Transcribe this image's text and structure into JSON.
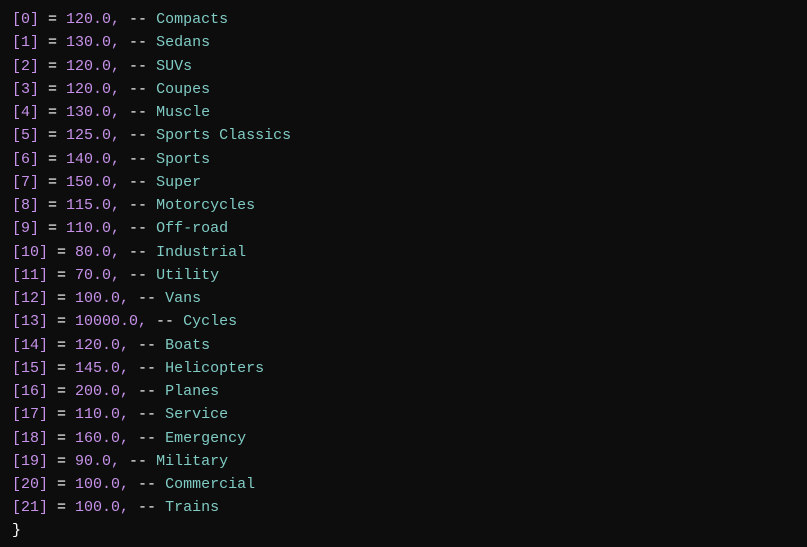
{
  "lines": [
    {
      "index": "[0]",
      "value": "120.0",
      "category": "Compacts"
    },
    {
      "index": "[1]",
      "value": "130.0",
      "category": "Sedans"
    },
    {
      "index": "[2]",
      "value": "120.0",
      "category": "SUVs"
    },
    {
      "index": "[3]",
      "value": "120.0",
      "category": "Coupes"
    },
    {
      "index": "[4]",
      "value": "130.0",
      "category": "Muscle"
    },
    {
      "index": "[5]",
      "value": "125.0",
      "category": "Sports Classics"
    },
    {
      "index": "[6]",
      "value": "140.0",
      "category": "Sports"
    },
    {
      "index": "[7]",
      "value": "150.0",
      "category": "Super"
    },
    {
      "index": "[8]",
      "value": "115.0",
      "category": "Motorcycles"
    },
    {
      "index": "[9]",
      "value": "110.0",
      "category": "Off-road"
    },
    {
      "index": "[10]",
      "value": "80.0",
      "category": "Industrial"
    },
    {
      "index": "[11]",
      "value": "70.0",
      "category": "Utility"
    },
    {
      "index": "[12]",
      "value": "100.0",
      "category": "Vans"
    },
    {
      "index": "[13]",
      "value": "10000.0",
      "category": "Cycles"
    },
    {
      "index": "[14]",
      "value": "120.0",
      "category": "Boats"
    },
    {
      "index": "[15]",
      "value": "145.0",
      "category": "Helicopters"
    },
    {
      "index": "[16]",
      "value": "200.0",
      "category": "Planes"
    },
    {
      "index": "[17]",
      "value": "110.0",
      "category": "Service"
    },
    {
      "index": "[18]",
      "value": "160.0",
      "category": "Emergency"
    },
    {
      "index": "[19]",
      "value": "90.0",
      "category": "Military"
    },
    {
      "index": "[20]",
      "value": "100.0",
      "category": "Commercial"
    },
    {
      "index": "[21]",
      "value": "100.0",
      "category": "Trains"
    }
  ],
  "closing_brace": "}"
}
